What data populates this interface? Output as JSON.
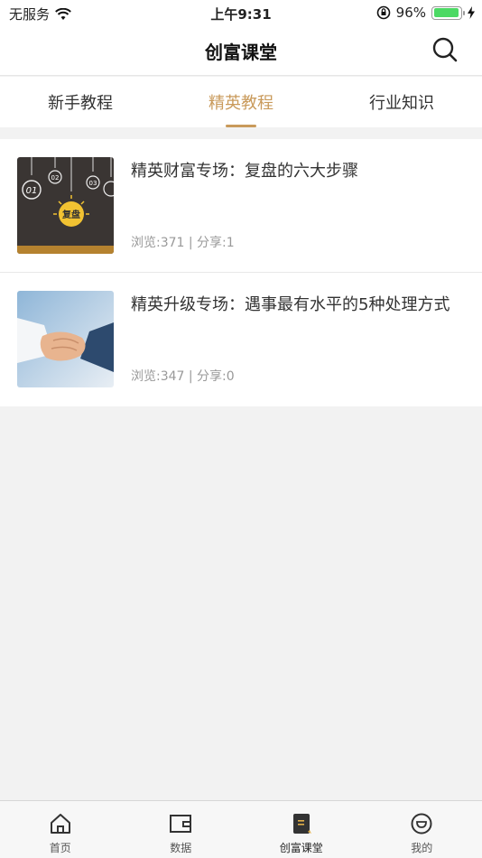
{
  "status_bar": {
    "carrier": "无服务",
    "time": "上午9:31",
    "battery_percent": "96%",
    "battery_level": 0.96
  },
  "nav": {
    "title": "创富课堂"
  },
  "top_tabs": [
    {
      "label": "新手教程",
      "active": false
    },
    {
      "label": "精英教程",
      "active": true
    },
    {
      "label": "行业知识",
      "active": false
    }
  ],
  "articles": [
    {
      "title": "精英财富专场：复盘的六大步骤",
      "meta": "浏览:371 | 分享:1",
      "thumb_text": "复盘",
      "thumb_labels": [
        "01",
        "02",
        "03"
      ]
    },
    {
      "title": "精英升级专场：遇事最有水平的5种处理方式",
      "meta": "浏览:347 | 分享:0"
    }
  ],
  "bottom_tabs": [
    {
      "label": "首页",
      "icon": "home-icon",
      "active": false
    },
    {
      "label": "数据",
      "icon": "wallet-icon",
      "active": false
    },
    {
      "label": "创富课堂",
      "icon": "book-icon",
      "active": true
    },
    {
      "label": "我的",
      "icon": "smile-icon",
      "active": false
    }
  ],
  "colors": {
    "accent": "#c99a5b",
    "background": "#f2f2f2",
    "battery": "#4cd964"
  }
}
